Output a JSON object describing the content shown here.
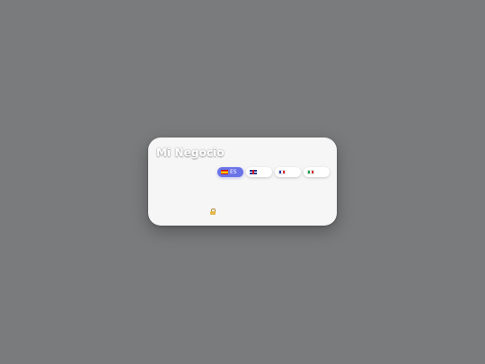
{
  "app": {
    "title": "Mi Negocio"
  },
  "languages": [
    {
      "code": "es",
      "label": "ES",
      "flag_icon": "spain-flag-icon",
      "active": true
    },
    {
      "code": "en",
      "label": "",
      "flag_icon": "uk-flag-icon",
      "active": false
    },
    {
      "code": "fr",
      "label": "",
      "flag_icon": "france-flag-icon",
      "active": false
    },
    {
      "code": "it",
      "label": "",
      "flag_icon": "italy-flag-icon",
      "active": false
    }
  ],
  "footer": {
    "icon": "lock-icon",
    "text": ""
  },
  "colors": {
    "backdrop": "#7a7b7c",
    "card": "#f6f6f7",
    "accent": "#6a74e8"
  }
}
